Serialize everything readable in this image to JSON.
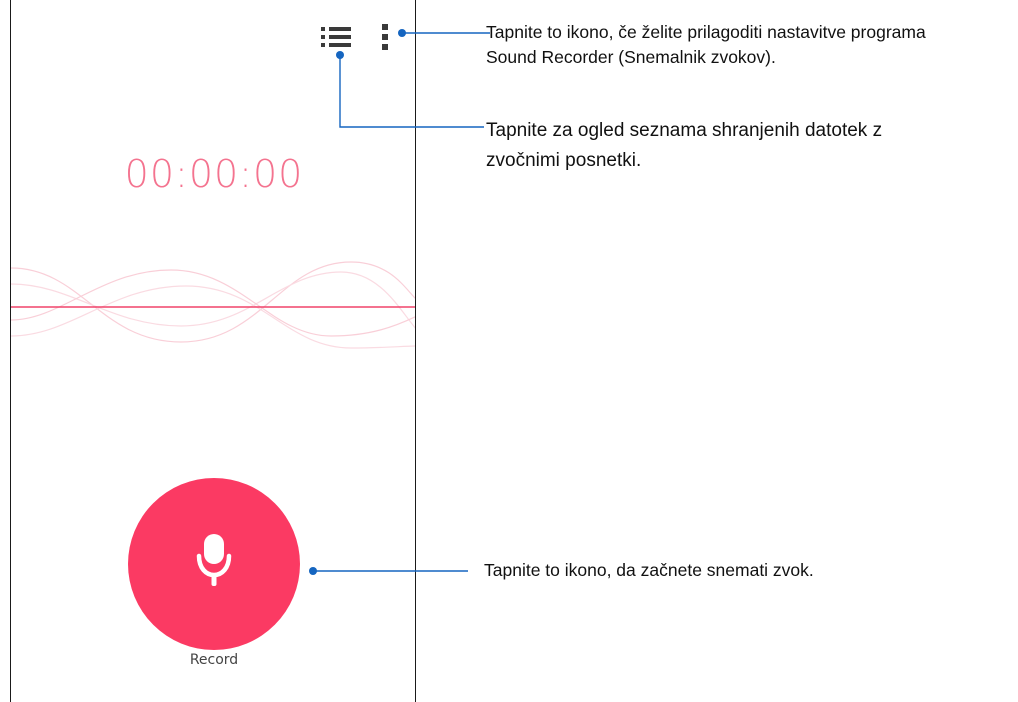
{
  "recorder": {
    "timer": "00:00:00",
    "record_label": "Record",
    "icons": {
      "list": "list-icon",
      "more": "more-vert-icon",
      "mic": "microphone-icon"
    },
    "colors": {
      "accent": "#fb3a63",
      "timer": "#f4738f",
      "wave": "#f9cfd8",
      "baseline": "#f0436a"
    }
  },
  "callouts": {
    "menu": {
      "line1": "Tapnite to ikono, če želite prilagoditi nastavitve programa",
      "line2": "Sound Recorder (Snemalnik zvokov)."
    },
    "list": {
      "line1": "Tapnite za ogled seznama shranjenih datotek z",
      "line2": "zvočnimi posnetki."
    },
    "record": {
      "line1": "Tapnite to ikono, da začnete snemati zvok."
    },
    "color": "#1565c0"
  }
}
